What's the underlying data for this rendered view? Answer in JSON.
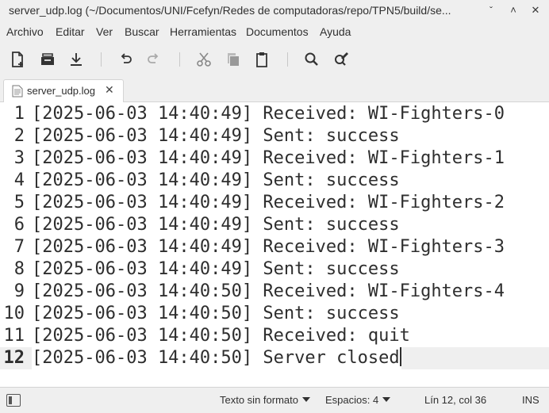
{
  "window": {
    "title": "server_udp.log (~/Documentos/UNI/Fcefyn/Redes de computadoras/repo/TPN5/build/se...",
    "minimize_glyph": "ˇ",
    "maximize_glyph": "˄",
    "close_glyph": "✕"
  },
  "menu": {
    "items": [
      "Archivo",
      "Editar",
      "Ver",
      "Buscar",
      "Herramientas",
      "Documentos",
      "Ayuda"
    ]
  },
  "toolbar": {
    "icons": [
      "new-document-icon",
      "open-icon",
      "save-icon",
      "undo-icon",
      "redo-icon",
      "cut-icon",
      "copy-icon",
      "paste-icon",
      "search-icon",
      "replace-icon"
    ]
  },
  "tabs": [
    {
      "label": "server_udp.log",
      "close_glyph": "✕"
    }
  ],
  "editor": {
    "current_line": 12,
    "lines": [
      {
        "num": "1",
        "text": "[2025-06-03 14:40:49] Received: WI-Fighters-0"
      },
      {
        "num": "2",
        "text": "[2025-06-03 14:40:49] Sent: success"
      },
      {
        "num": "3",
        "text": "[2025-06-03 14:40:49] Received: WI-Fighters-1"
      },
      {
        "num": "4",
        "text": "[2025-06-03 14:40:49] Sent: success"
      },
      {
        "num": "5",
        "text": "[2025-06-03 14:40:49] Received: WI-Fighters-2"
      },
      {
        "num": "6",
        "text": "[2025-06-03 14:40:49] Sent: success"
      },
      {
        "num": "7",
        "text": "[2025-06-03 14:40:49] Received: WI-Fighters-3"
      },
      {
        "num": "8",
        "text": "[2025-06-03 14:40:49] Sent: success"
      },
      {
        "num": "9",
        "text": "[2025-06-03 14:40:50] Received: WI-Fighters-4"
      },
      {
        "num": "10",
        "text": "[2025-06-03 14:40:50] Sent: success"
      },
      {
        "num": "11",
        "text": "[2025-06-03 14:40:50] Received: quit"
      },
      {
        "num": "12",
        "text": "[2025-06-03 14:40:50] Server closed"
      }
    ]
  },
  "statusbar": {
    "format": "Texto sin formato",
    "spaces": "Espacios: 4",
    "position": "Lín 12, col 36",
    "mode": "INS"
  }
}
